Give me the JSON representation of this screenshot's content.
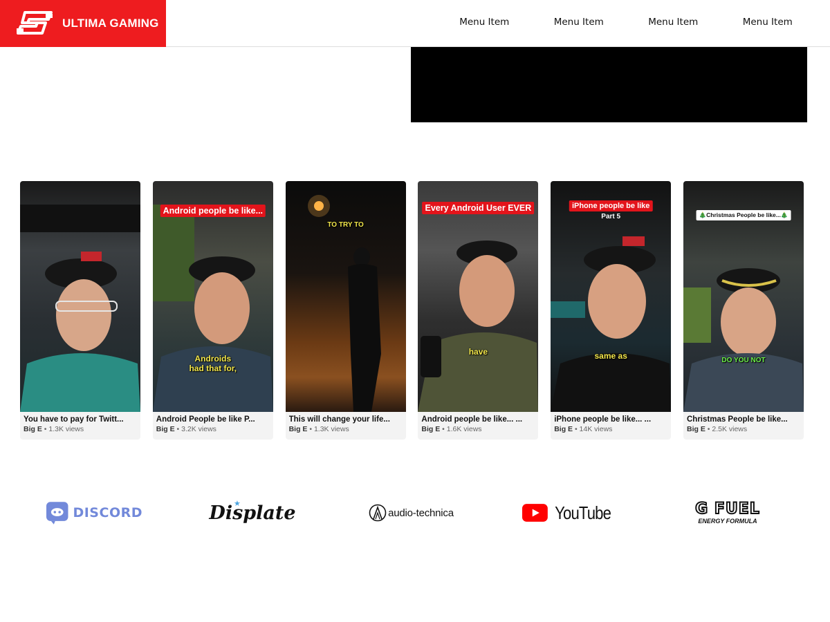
{
  "brand": {
    "name": "ULTIMA GAMING",
    "color": "#ee1c1f",
    "logo_icon": "ultima-logo-icon"
  },
  "nav": {
    "items": [
      "Menu Item",
      "Menu Item",
      "Menu Item",
      "Menu Item"
    ]
  },
  "player": {
    "background": "#000000"
  },
  "videos": [
    {
      "title": "You have to pay for Twitt...",
      "author": "Big E",
      "views": "1.3K views",
      "overlay": []
    },
    {
      "title": "Android People be like P...",
      "author": "Big E",
      "views": "3.2K views",
      "overlay": [
        "Android people be like...",
        "Androids",
        "had that for,"
      ]
    },
    {
      "title": "This will change your life...",
      "author": "Big E",
      "views": "1.3K views",
      "overlay": [
        "TO TRY TO"
      ]
    },
    {
      "title": "Android people be like... ...",
      "author": "Big E",
      "views": "1.6K views",
      "overlay": [
        "Every Android User EVER",
        "have"
      ]
    },
    {
      "title": "iPhone people be like... ...",
      "author": "Big E",
      "views": "14K views",
      "overlay": [
        "iPhone people be like",
        "Part 5",
        "same as"
      ]
    },
    {
      "title": "Christmas People be like...",
      "author": "Big E",
      "views": "2.5K views",
      "overlay": [
        "🎄Christmas People be like...🎄",
        "DO YOU NOT"
      ]
    }
  ],
  "partners": [
    {
      "name": "DISCORD",
      "icon": "discord-icon",
      "color": "#7289da"
    },
    {
      "name": "Displate",
      "icon": "displate-star-icon",
      "color": "#4aa3df"
    },
    {
      "name": "audio-technica",
      "icon": "audio-technica-icon",
      "color": "#111111"
    },
    {
      "name": "YouTube",
      "icon": "youtube-play-icon",
      "color": "#ff0000"
    },
    {
      "name": "G FUEL",
      "tagline": "ENERGY FORMULA",
      "icon": "gfuel-icon",
      "color": "#111111"
    }
  ]
}
